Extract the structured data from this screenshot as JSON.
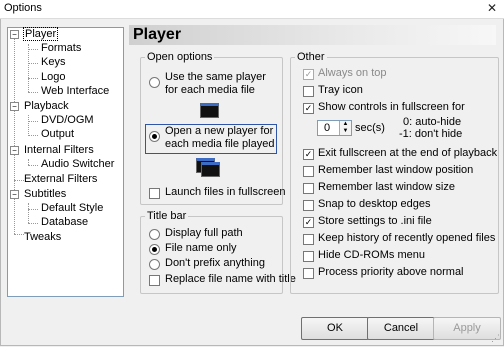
{
  "window": {
    "title": "Options",
    "close_glyph": "✕"
  },
  "tree": {
    "items": [
      {
        "label": "Player"
      },
      {
        "label": "Formats"
      },
      {
        "label": "Keys"
      },
      {
        "label": "Logo"
      },
      {
        "label": "Web Interface"
      },
      {
        "label": "Playback"
      },
      {
        "label": "DVD/OGM"
      },
      {
        "label": "Output"
      },
      {
        "label": "Internal Filters"
      },
      {
        "label": "Audio Switcher"
      },
      {
        "label": "External Filters"
      },
      {
        "label": "Subtitles"
      },
      {
        "label": "Default Style"
      },
      {
        "label": "Database"
      },
      {
        "label": "Tweaks"
      }
    ],
    "expander_glyph": "−"
  },
  "page": {
    "title": "Player"
  },
  "open_options": {
    "title": "Open options",
    "same_player": "Use the same player for each media file",
    "new_player": "Open a new player for each media file played",
    "launch_fullscreen": "Launch files in fullscreen"
  },
  "title_bar": {
    "title": "Title bar",
    "display_full_path": "Display full path",
    "file_name_only": "File name only",
    "dont_prefix": "Don't prefix anything",
    "replace_file_name": "Replace file name with title"
  },
  "other": {
    "title": "Other",
    "always_on_top": "Always on top",
    "tray_icon": "Tray icon",
    "show_controls": "Show controls in fullscreen for",
    "secs_value": "0",
    "secs_unit": "sec(s)",
    "hint1": "0: auto-hide",
    "hint2": "-1: don't hide",
    "exit_fullscreen": "Exit fullscreen at the end of playback",
    "remember_position": "Remember last window position",
    "remember_size": "Remember last window size",
    "snap_edges": "Snap to desktop edges",
    "store_ini": "Store settings to .ini file",
    "keep_history": "Keep history of recently opened files",
    "hide_cdroms": "Hide CD-ROMs menu",
    "process_priority": "Process priority above normal"
  },
  "buttons": {
    "ok": "OK",
    "cancel": "Cancel",
    "apply": "Apply"
  },
  "check_glyph": "✓"
}
